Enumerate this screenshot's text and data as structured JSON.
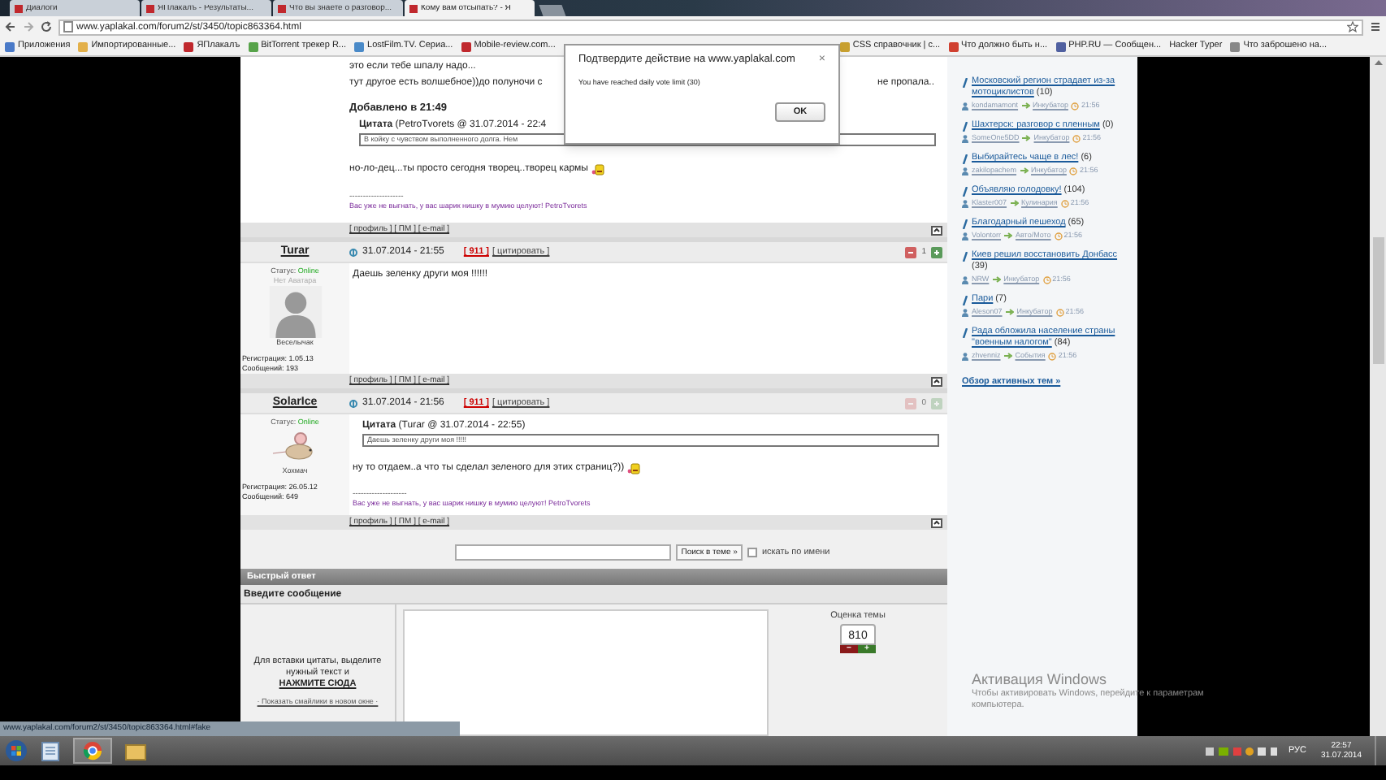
{
  "browser": {
    "tabs": [
      {
        "label": "Диалоги",
        "selected": false
      },
      {
        "label": "ЯПлакалъ - Результаты...",
        "selected": false
      },
      {
        "label": "Что вы знаете о разговор...",
        "selected": false
      },
      {
        "label": "Кому вам отсыпать? - Я",
        "selected": true
      }
    ],
    "address": "www.yaplakal.com/forum2/st/3450/topic863364.html",
    "bookmarks": [
      "Приложения",
      "Импортированные...",
      "ЯПлакалъ",
      "BitTorrent трекер R...",
      "LostFilm.TV. Сериа...",
      "Mobile-review.com...",
      "CSS справочник | c...",
      "Что должно быть н...",
      "PHP.RU — Сообщен...",
      "Hacker Typer",
      "Что заброшено на..."
    ]
  },
  "dialog": {
    "title": "Подтвердите действие на www.yaplakal.com",
    "close": "×",
    "message": "You have reached daily vote limit (30)",
    "button": "OK"
  },
  "top_post": {
    "lines": [
      "это если тебе шпалу надо...",
      "тут другое есть волшебное))до полуночи с",
      "не пропала.."
    ],
    "added": "Добавлено в 21:49",
    "quote_header": "**Цитата** (PetroTvorets @ 31.07.2014 - 22:4",
    "quote_text": "В койку с чувством выполненного долга. Нем",
    "text": "но-ло-дец...ты просто сегодня творец..творец кармы",
    "signature_rule": "--------------------",
    "signature": "Вас уже не выгнать, у вас шарик нишку в мумию целуют! PetroTvorets",
    "footer": "[ профиль ] [ ПМ ] [ e-mail ]"
  },
  "posts": [
    {
      "author": "Turar",
      "date": "31.07.2014 - 21:55",
      "report": "[ 911 ]",
      "quote_link": "[ цитировать ]",
      "status_label": "Статус:",
      "status": "Online",
      "avatar_caption": "Нет Аватара",
      "avatar": {
        "kind": "silhouette"
      },
      "rank": "Веселычак",
      "registered": "Регистрация: 1.05.13",
      "messages": "Сообщений: 193",
      "votes": "1",
      "votes_enabled": true,
      "text": "Даешь зеленку други моя !!!!!!",
      "footer": "[ профиль ] [ ПМ ] [ e-mail ]"
    },
    {
      "author": "SolarIce",
      "date": "31.07.2014 - 21:56",
      "report": "[ 911 ]",
      "quote_link": "[ цитировать ]",
      "status_label": "Статус:",
      "status": "Online",
      "avatar": {
        "kind": "mouse"
      },
      "rank": "Хохмач",
      "registered": "Регистрация: 26.05.12",
      "messages": "Сообщений: 649",
      "votes": "0",
      "votes_enabled": false,
      "quote_header": "**Цитата** (Turar @ 31.07.2014 - 22:55)",
      "quote_text": "Даешь зеленку други моя !!!!!",
      "text": "ну то отдаем..а что ты сделал зеленого для этих страниц?))",
      "signature_rule": "--------------------",
      "signature": "Вас уже не выгнать, у вас шарик нишку в мумию целуют! PetroTvorets",
      "footer": "[ профиль ] [ ПМ ] [ e-mail ]"
    }
  ],
  "search": {
    "button": "Поиск в теме »",
    "by_name": {
      "label": "искать по имени",
      "checked": false
    }
  },
  "quick_reply": {
    "title": "Быстрый ответ",
    "prompt": "Введите сообщение",
    "hint": "Для вставки цитаты, выделите нужный текст и",
    "hint_link": "НАЖМИТЕ СЮДА",
    "smilies_link": "· Показать смайлики в новом окне ·",
    "rating_label": "Оценка темы",
    "rating": "810",
    "minus": "−",
    "plus": "+"
  },
  "sidebar": {
    "topics": [
      {
        "title": "Московский регион страдает из-за мотоциклистов",
        "count": "(10)",
        "user": "kondamamont",
        "section": "Инкубатор",
        "time": "21:56"
      },
      {
        "title": "Шахтерск: разговор с пленным",
        "count": "(0)",
        "user": "SomeOne5DD",
        "section": "Инкубатор",
        "time": "21:56"
      },
      {
        "title": "Выбирайтесь чаще в лес!",
        "count": "(6)",
        "user": "zakilopachem",
        "section": "Инкубатор",
        "time": "21:56"
      },
      {
        "title": "Объявляю голодовку!",
        "count": "(104)",
        "user": "Klaster007",
        "section": "Кулинария",
        "time": "21:56"
      },
      {
        "title": "Благодарный пешеход",
        "count": "(65)",
        "user": "Volontorr",
        "section": "Авто/Мото",
        "time": "21:56"
      },
      {
        "title": "Киев решил восстановить Донбасс",
        "count": "(39)",
        "user": "NRW",
        "section": "Инкубатор",
        "time": "21:56"
      },
      {
        "title": "Пари",
        "count": "(7)",
        "user": "Aleson07",
        "section": "Инкубатор",
        "time": "21:56"
      },
      {
        "title": "Рада обложила население страны \"военным налогом\"",
        "count": "(84)",
        "user": "zhvenniz",
        "section": "События",
        "time": "21:56"
      }
    ],
    "more": "Обзор активных тем »"
  },
  "activation": {
    "title": "Активация Windows",
    "text": "Чтобы активировать Windows, перейдите к параметрам компьютера."
  },
  "status_url": "www.yaplakal.com/forum2/st/3450/topic863364.html#fake",
  "taskbar": {
    "language": "РУС",
    "time": "22:57",
    "date": "31.07.2014"
  }
}
